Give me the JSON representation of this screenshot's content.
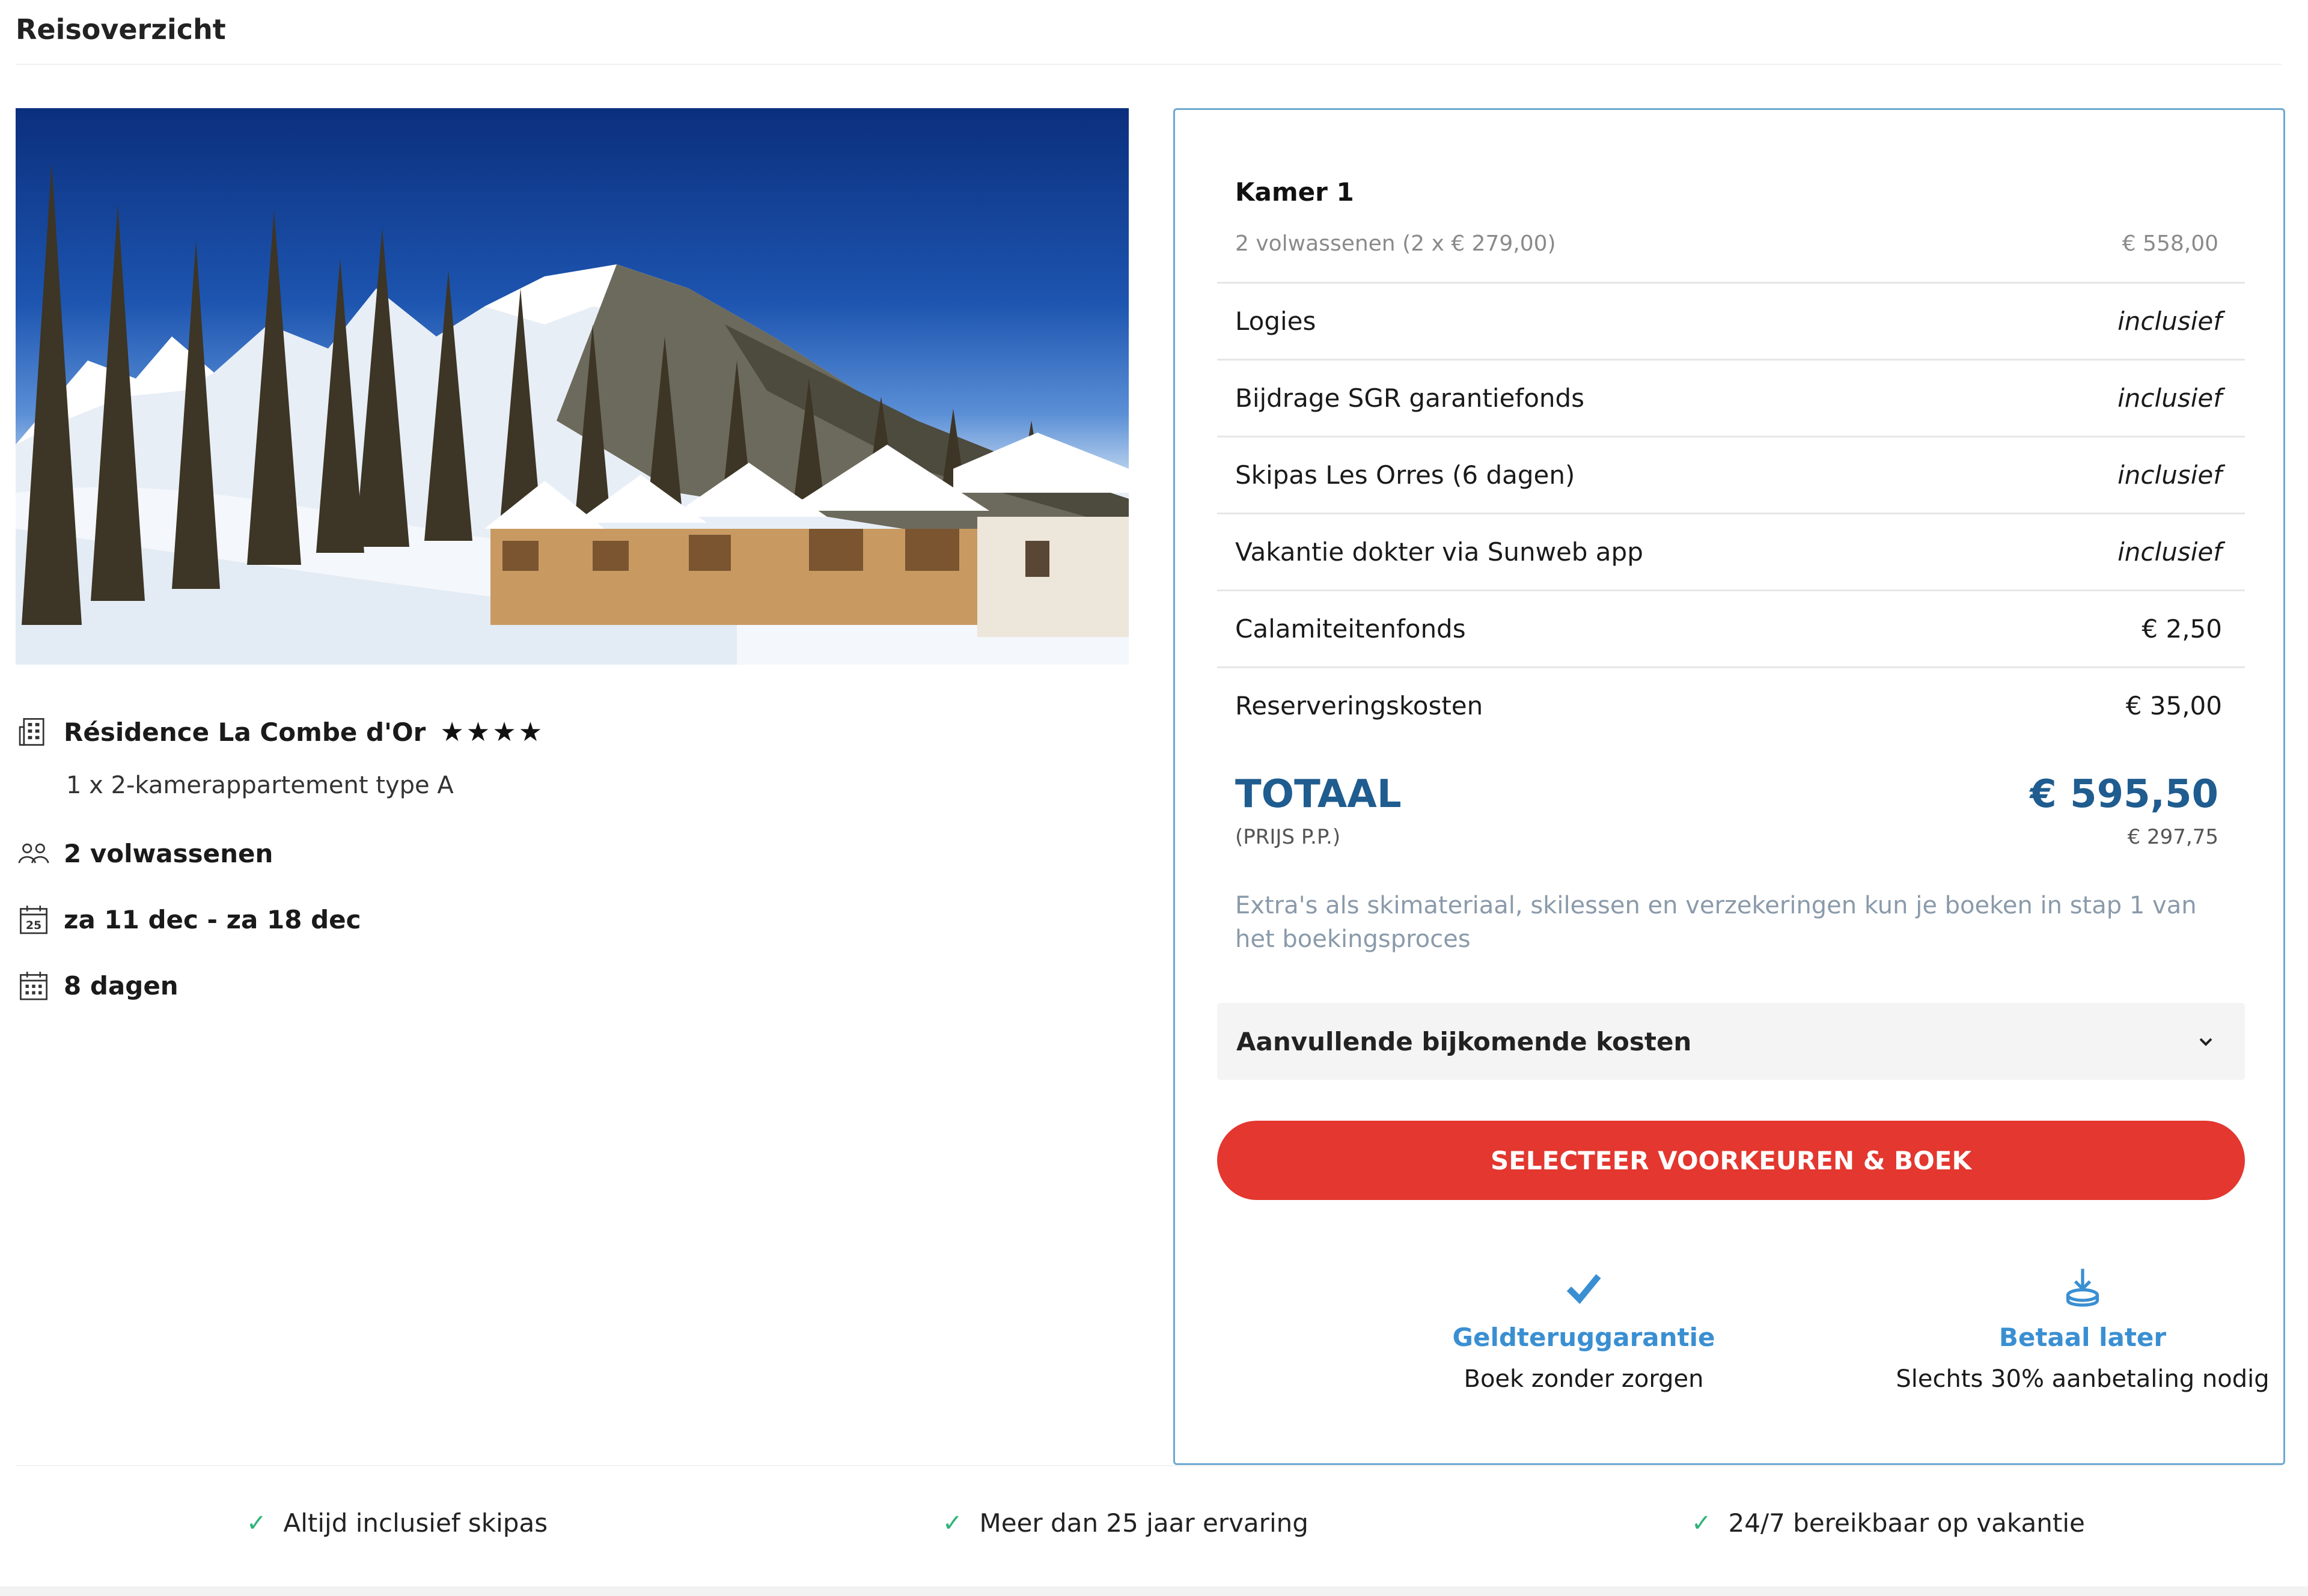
{
  "page": {
    "title": "Reisoverzicht"
  },
  "accommodation": {
    "name": "Résidence La Combe d'Or",
    "stars": "★★★★",
    "rooms": "1 x 2-kamerappartement type A",
    "travellers": "2 volwassenen",
    "dates": "za 11 dec - za 18 dec",
    "duration": "8 dagen",
    "calendar_day": "25"
  },
  "summary": {
    "room_title": "Kamer 1",
    "room_sub": "2 volwassenen (2 x € 279,00)",
    "room_sub_value": "€ 558,00",
    "lines": [
      {
        "label": "Logies",
        "value": "inclusief"
      },
      {
        "label": "Bijdrage SGR garantiefonds",
        "value": "inclusief"
      },
      {
        "label": "Skipas Les Orres (6 dagen)",
        "value": "inclusief"
      },
      {
        "label": "Vakantie dokter via Sunweb app",
        "value": "inclusief"
      },
      {
        "label": "Calamiteitenfonds",
        "value": "€ 2,50"
      },
      {
        "label": "Reserveringskosten",
        "value": "€ 35,00"
      }
    ],
    "total_label": "TOTAAL",
    "total_value": "€ 595,50",
    "pp_label": "(PRIJS P.P.)",
    "pp_value": "€ 297,75",
    "extras_note": "Extra's als skimateriaal, skilessen en verzekeringen kun je boeken in stap 1 van het boekingsproces",
    "accordion_label": "Aanvullende bijkomende kosten",
    "cta_label": "SELECTEER VOORKEUREN & BOEK"
  },
  "usps": [
    {
      "title": "Geldteruggarantie",
      "sub": "Boek zonder zorgen",
      "icon": "check-icon"
    },
    {
      "title": "Betaal later",
      "sub": "Slechts 30% aanbetaling nodig",
      "icon": "download-coin-icon"
    }
  ],
  "footer": [
    {
      "text": "Altijd inclusief skipas"
    },
    {
      "text": "Meer dan 25 jaar ervaring"
    },
    {
      "text": "24/7 bereikbaar op vakantie"
    }
  ],
  "colors": {
    "accent_blue": "#1f5c8f",
    "link_blue": "#3a8fd2",
    "cta_red": "#e3372f",
    "check_green": "#2db37a",
    "panel_border": "#6fa8d2"
  }
}
